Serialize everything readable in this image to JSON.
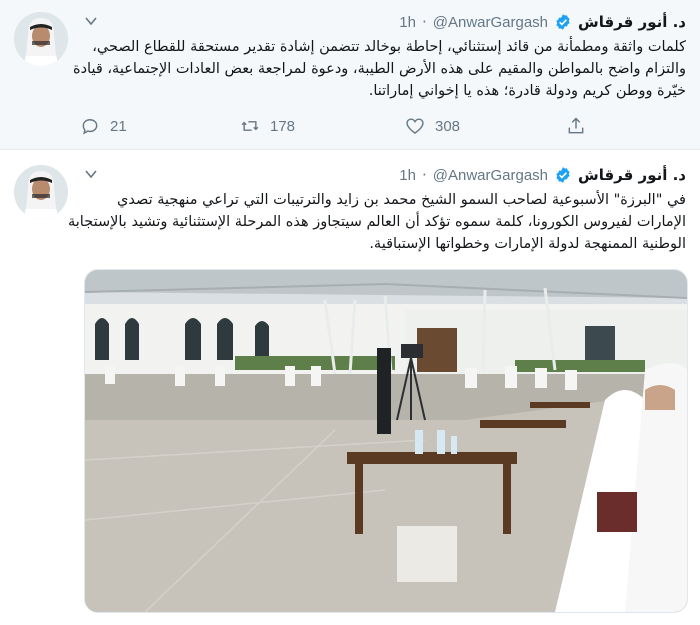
{
  "tweets": [
    {
      "display_name": "د. أنور قرقاش",
      "handle": "@AnwarGargash",
      "separator": "·",
      "time": "1h",
      "text_lines": [
        "كلمات واثقة ومطمأنة من قائد إستثنائي، إحاطة بوخالد تتضمن إشادة تقدير مستحقة للقطاع الصحي،",
        "والتزام واضح بالمواطن والمقيم على هذه الأرض الطيبة، ودعوة لمراجعة بعض العادات الإجتماعية، قيادة",
        "خيّرة ووطن كريم ودولة قادرة؛ هذه يا إخواني إماراتنا."
      ],
      "replies": "21",
      "retweets": "178",
      "likes": "308"
    },
    {
      "display_name": "د. أنور قرقاش",
      "handle": "@AnwarGargash",
      "separator": "·",
      "time": "1h",
      "text_lines": [
        "في \"البرزة\" الأسبوعية لصاحب السمو الشيخ محمد بن زايد والترتيبات التي تراعي منهجية تصدي",
        "الإمارات لفيروس الكورونا، كلمة سموه تؤكد أن العالم سيتجاوز هذه المرحلة الإستثنائية وتشيد بالإستجابة",
        "الوطنية الممنهجة لدولة الإمارات وخطواتها الإستباقية."
      ]
    }
  ],
  "icons": {
    "verified": "verified-badge-icon",
    "caret": "chevron-down-icon",
    "reply": "reply-icon",
    "retweet": "retweet-icon",
    "like": "heart-icon",
    "share": "share-icon"
  },
  "colors": {
    "verified": "#1da1f2",
    "muted": "#657786",
    "selected_background": "#f5f8fa"
  }
}
